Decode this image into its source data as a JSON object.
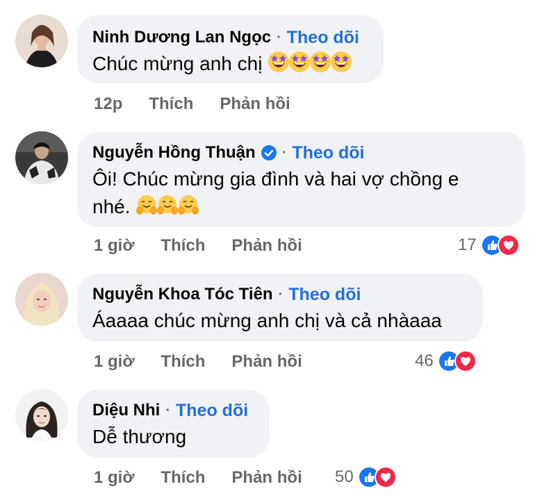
{
  "comments": [
    {
      "name": "Ninh Dương Lan Ngọc",
      "follow": "Theo dõi",
      "text": "Chúc mừng anh chị",
      "emoji_icon": "star-struck-emoji-icon",
      "emoji_count": 4,
      "time": "12p",
      "like": "Thích",
      "reply": "Phản hồi",
      "reaction_count": ""
    },
    {
      "name": "Nguyễn Hồng Thuận",
      "verified": true,
      "follow": "Theo dõi",
      "text_line1": "Ôi! Chúc mừng gia đình và hai vợ chồng e",
      "text_line2": "nhé.",
      "emoji_icon": "hugging-face-emoji-icon",
      "emoji_count": 3,
      "time": "1 giờ",
      "like": "Thích",
      "reply": "Phản hồi",
      "reaction_count": "17"
    },
    {
      "name": "Nguyễn Khoa Tóc Tiên",
      "follow": "Theo dõi",
      "text": "Áaaaa chúc mừng anh chị và cả nhàaaa",
      "time": "1 giờ",
      "like": "Thích",
      "reply": "Phản hồi",
      "reaction_count": "46"
    },
    {
      "name": "Diệu Nhi",
      "follow": "Theo dõi",
      "text": "Dễ thương",
      "time": "1 giờ",
      "like": "Thích",
      "reply": "Phản hồi",
      "reaction_count": "50"
    }
  ],
  "colors": {
    "bubble": "#f0f2f5",
    "follow_link": "#216fdb",
    "meta_text": "#65676b",
    "like_reaction": "#1877f2",
    "love_reaction": "#f02849"
  }
}
